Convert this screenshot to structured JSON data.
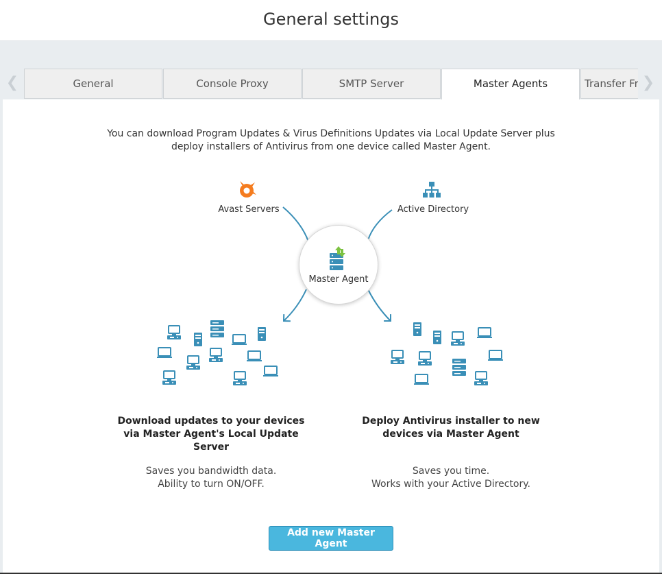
{
  "header": {
    "title": "General settings"
  },
  "tabs": [
    {
      "label": "General",
      "active": false
    },
    {
      "label": "Console Proxy",
      "active": false
    },
    {
      "label": "SMTP Server",
      "active": false
    },
    {
      "label": "Master Agents",
      "active": true
    },
    {
      "label": "Transfer From",
      "active": false
    }
  ],
  "nav": {
    "prev_icon": "chevron-left-icon",
    "next_icon": "chevron-right-icon"
  },
  "intro": "You can download Program Updates & Virus Definitions Updates via Local Update Server plus deploy installers of Antivirus from one device called Master Agent.",
  "diagram": {
    "source_left": {
      "label": "Avast Servers",
      "icon": "avast-logo-icon"
    },
    "source_right": {
      "label": "Active Directory",
      "icon": "hierarchy-icon"
    },
    "hub": {
      "label": "Master Agent",
      "icon": "server-sync-icon"
    }
  },
  "features": [
    {
      "title": "Download updates to your devices via Master Agent's Local Update Server",
      "lines": [
        "Saves you bandwidth data.",
        "Ability to turn ON/OFF."
      ]
    },
    {
      "title": "Deploy Antivirus installer to new devices via Master Agent",
      "lines": [
        "Saves you time.",
        "Works with your Active Directory."
      ]
    }
  ],
  "actions": {
    "add_label": "Add new Master Agent"
  },
  "colors": {
    "accent": "#4ab7de",
    "icon": "#3a8fb7",
    "avast": "#f57c1f",
    "sync_green": "#7dc242"
  }
}
